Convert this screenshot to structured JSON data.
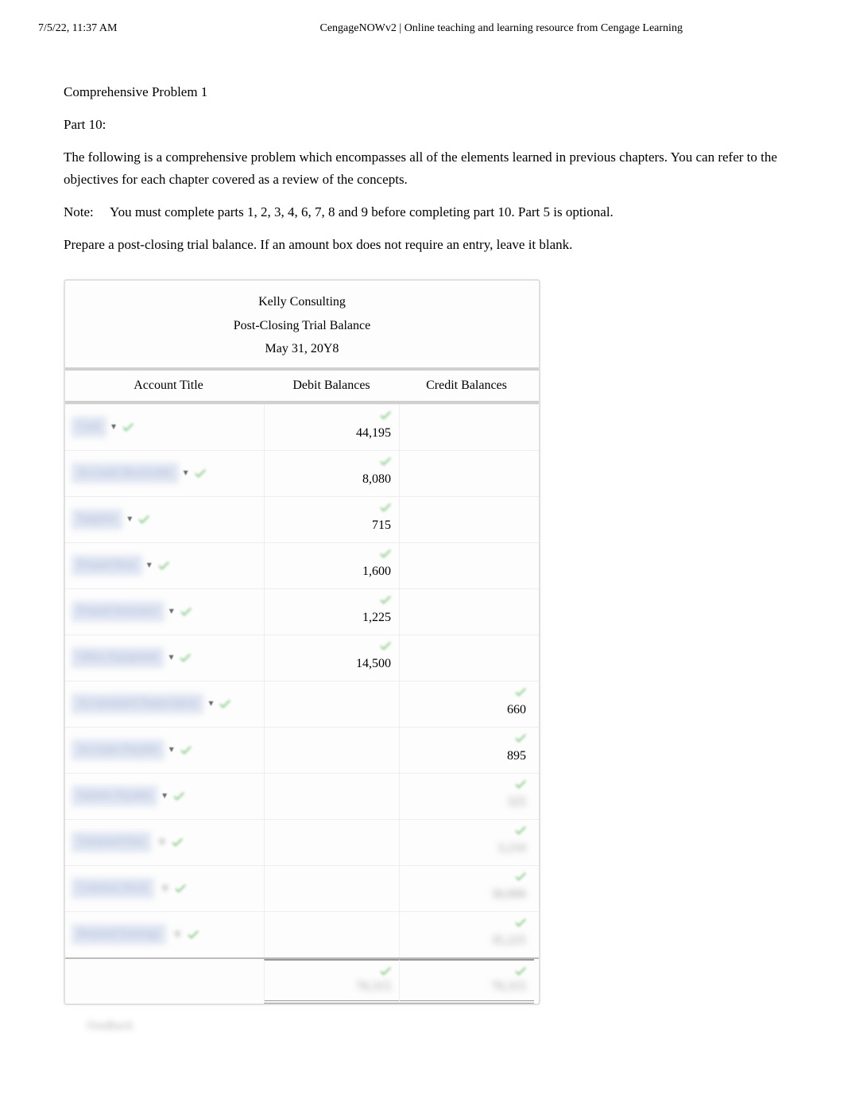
{
  "header": {
    "timestamp": "7/5/22, 11:37 AM",
    "title": "CengageNOWv2 | Online teaching and learning resource from Cengage Learning"
  },
  "problem": {
    "heading": "Comprehensive Problem 1",
    "part": "Part 10:",
    "intro": "The following is a comprehensive problem which encompasses all of the elements learned in previous chapters. You can refer to the objectives for each chapter covered as a review of the concepts.",
    "note_label": "Note:",
    "note_text": "You must complete parts 1, 2, 3, 4, 6, 7, 8 and 9 before completing part 10. Part 5 is optional.",
    "instruction": "Prepare a post-closing trial balance. If an amount box does not require an entry, leave it blank."
  },
  "trial_balance": {
    "company": "Kelly Consulting",
    "title": "Post-Closing Trial Balance",
    "date": "May 31, 20Y8",
    "columns": {
      "account": "Account Title",
      "debit": "Debit Balances",
      "credit": "Credit Balances"
    },
    "rows": [
      {
        "account": "Cash",
        "debit": "44,195",
        "credit": "",
        "blur_credit": false,
        "blur_debit": false,
        "has_dropdown": true
      },
      {
        "account": "Accounts Receivable",
        "debit": "8,080",
        "credit": "",
        "blur_credit": false,
        "blur_debit": false,
        "has_dropdown": true
      },
      {
        "account": "Supplies",
        "debit": "715",
        "credit": "",
        "blur_credit": false,
        "blur_debit": false,
        "has_dropdown": true
      },
      {
        "account": "Prepaid Rent",
        "debit": "1,600",
        "credit": "",
        "blur_credit": false,
        "blur_debit": false,
        "has_dropdown": true
      },
      {
        "account": "Prepaid Insurance",
        "debit": "1,225",
        "credit": "",
        "blur_credit": false,
        "blur_debit": false,
        "has_dropdown": true
      },
      {
        "account": "Office Equipment",
        "debit": "14,500",
        "credit": "",
        "blur_credit": false,
        "blur_debit": false,
        "has_dropdown": true
      },
      {
        "account": "Accumulated Depreciation",
        "debit": "",
        "credit": "660",
        "blur_credit": false,
        "blur_debit": false,
        "has_dropdown": true
      },
      {
        "account": "Accounts Payable",
        "debit": "",
        "credit": "895",
        "blur_credit": false,
        "blur_debit": false,
        "has_dropdown": true
      },
      {
        "account": "Salaries Payable",
        "debit": "",
        "credit": "325",
        "blur_credit": true,
        "blur_debit": false,
        "has_dropdown": true
      },
      {
        "account": "Unearned Fees",
        "debit": "",
        "credit": "3,210",
        "blur_credit": true,
        "blur_debit": false,
        "has_dropdown": false
      },
      {
        "account": "Common Stock",
        "debit": "",
        "credit": "30,000",
        "blur_credit": true,
        "blur_debit": false,
        "has_dropdown": false
      },
      {
        "account": "Retained Earnings",
        "debit": "",
        "credit": "35,225",
        "blur_credit": true,
        "blur_debit": false,
        "has_dropdown": false
      }
    ],
    "totals": {
      "debit": "70,315",
      "credit": "70,315"
    }
  },
  "feedback_label": "Feedback"
}
